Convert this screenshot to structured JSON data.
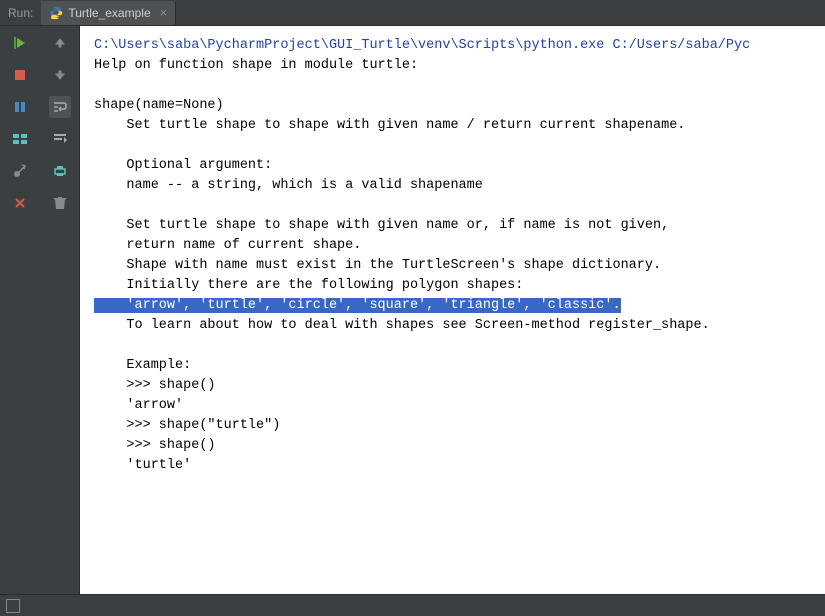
{
  "topbar": {
    "run_label": "Run:",
    "tab_label": "Turtle_example"
  },
  "console": {
    "cmd_path": "C:\\Users\\saba\\PycharmProject\\GUI_Turtle\\venv\\Scripts\\python.exe C:/Users/saba/Pyc",
    "help_header": "Help on function shape in module turtle:",
    "blank": "",
    "sig": "shape(name=None)",
    "desc1": "    Set turtle shape to shape with given name / return current shapename.",
    "opt_header": "    Optional argument:",
    "opt_name": "    name -- a string, which is a valid shapename",
    "setdesc1": "    Set turtle shape to shape with given name or, if name is not given,",
    "setdesc2": "    return name of current shape.",
    "setdesc3": "    Shape with name must exist in the TurtleScreen's shape dictionary.",
    "setdesc4": "    Initially there are the following polygon shapes:",
    "shape_list": "    'arrow', 'turtle', 'circle', 'square', 'triangle', 'classic'.",
    "learn": "    To learn about how to deal with shapes see Screen-method register_shape.",
    "example_hdr": "    Example:",
    "ex1": "    >>> shape()",
    "ex2": "    'arrow'",
    "ex3": "    >>> shape(\"turtle\")",
    "ex4": "    >>> shape()",
    "ex5": "    'turtle'"
  }
}
